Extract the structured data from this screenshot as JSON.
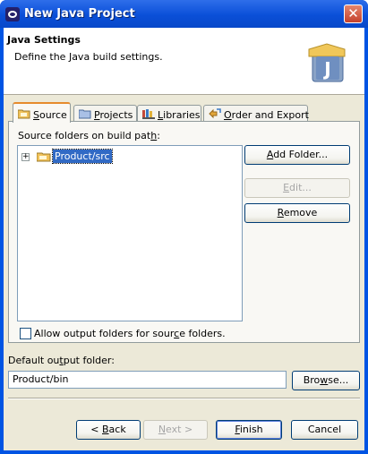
{
  "window": {
    "title": "New Java Project"
  },
  "header": {
    "title": "Java Settings",
    "description": "Define the Java build settings.",
    "badge_letter": "J"
  },
  "tabs": [
    {
      "label": "Source",
      "mnemonic": "S",
      "rest": "ource",
      "active": true
    },
    {
      "label": "Projects",
      "mnemonic": "P",
      "rest": "rojects",
      "active": false
    },
    {
      "label": "Libraries",
      "mnemonic": "L",
      "rest": "ibraries",
      "active": false
    },
    {
      "label": "Order and Export",
      "mnemonic": "O",
      "rest": "rder and Export",
      "active": false
    }
  ],
  "source": {
    "label_pre": "Source folders on build pat",
    "label_mn": "h",
    "label_post": ":",
    "tree_items": [
      {
        "label": "Product/src",
        "selected": true
      }
    ],
    "buttons": {
      "add_folder_pre": "",
      "add_folder_mn": "A",
      "add_folder_post": "dd Folder...",
      "edit_pre": "",
      "edit_mn": "E",
      "edit_post": "dit...",
      "remove_pre": "",
      "remove_mn": "R",
      "remove_post": "emove"
    },
    "checkbox_pre": "Allow output folders for sour",
    "checkbox_mn": "c",
    "checkbox_post": "e folders.",
    "checkbox_checked": false
  },
  "output": {
    "label_pre": "Default ou",
    "label_mn": "t",
    "label_post": "put folder:",
    "value": "Product/bin",
    "browse_pre": "Bro",
    "browse_mn": "w",
    "browse_post": "se..."
  },
  "footer": {
    "back_pre": "< ",
    "back_mn": "B",
    "back_post": "ack",
    "next_pre": "",
    "next_mn": "N",
    "next_post": "ext >",
    "finish_pre": "",
    "finish_mn": "F",
    "finish_post": "inish",
    "cancel": "Cancel"
  },
  "colors": {
    "titlebar": "#0a4fd8",
    "client": "#ece9d8",
    "selection": "#316ac5",
    "tab_accent": "#e68b2c"
  }
}
